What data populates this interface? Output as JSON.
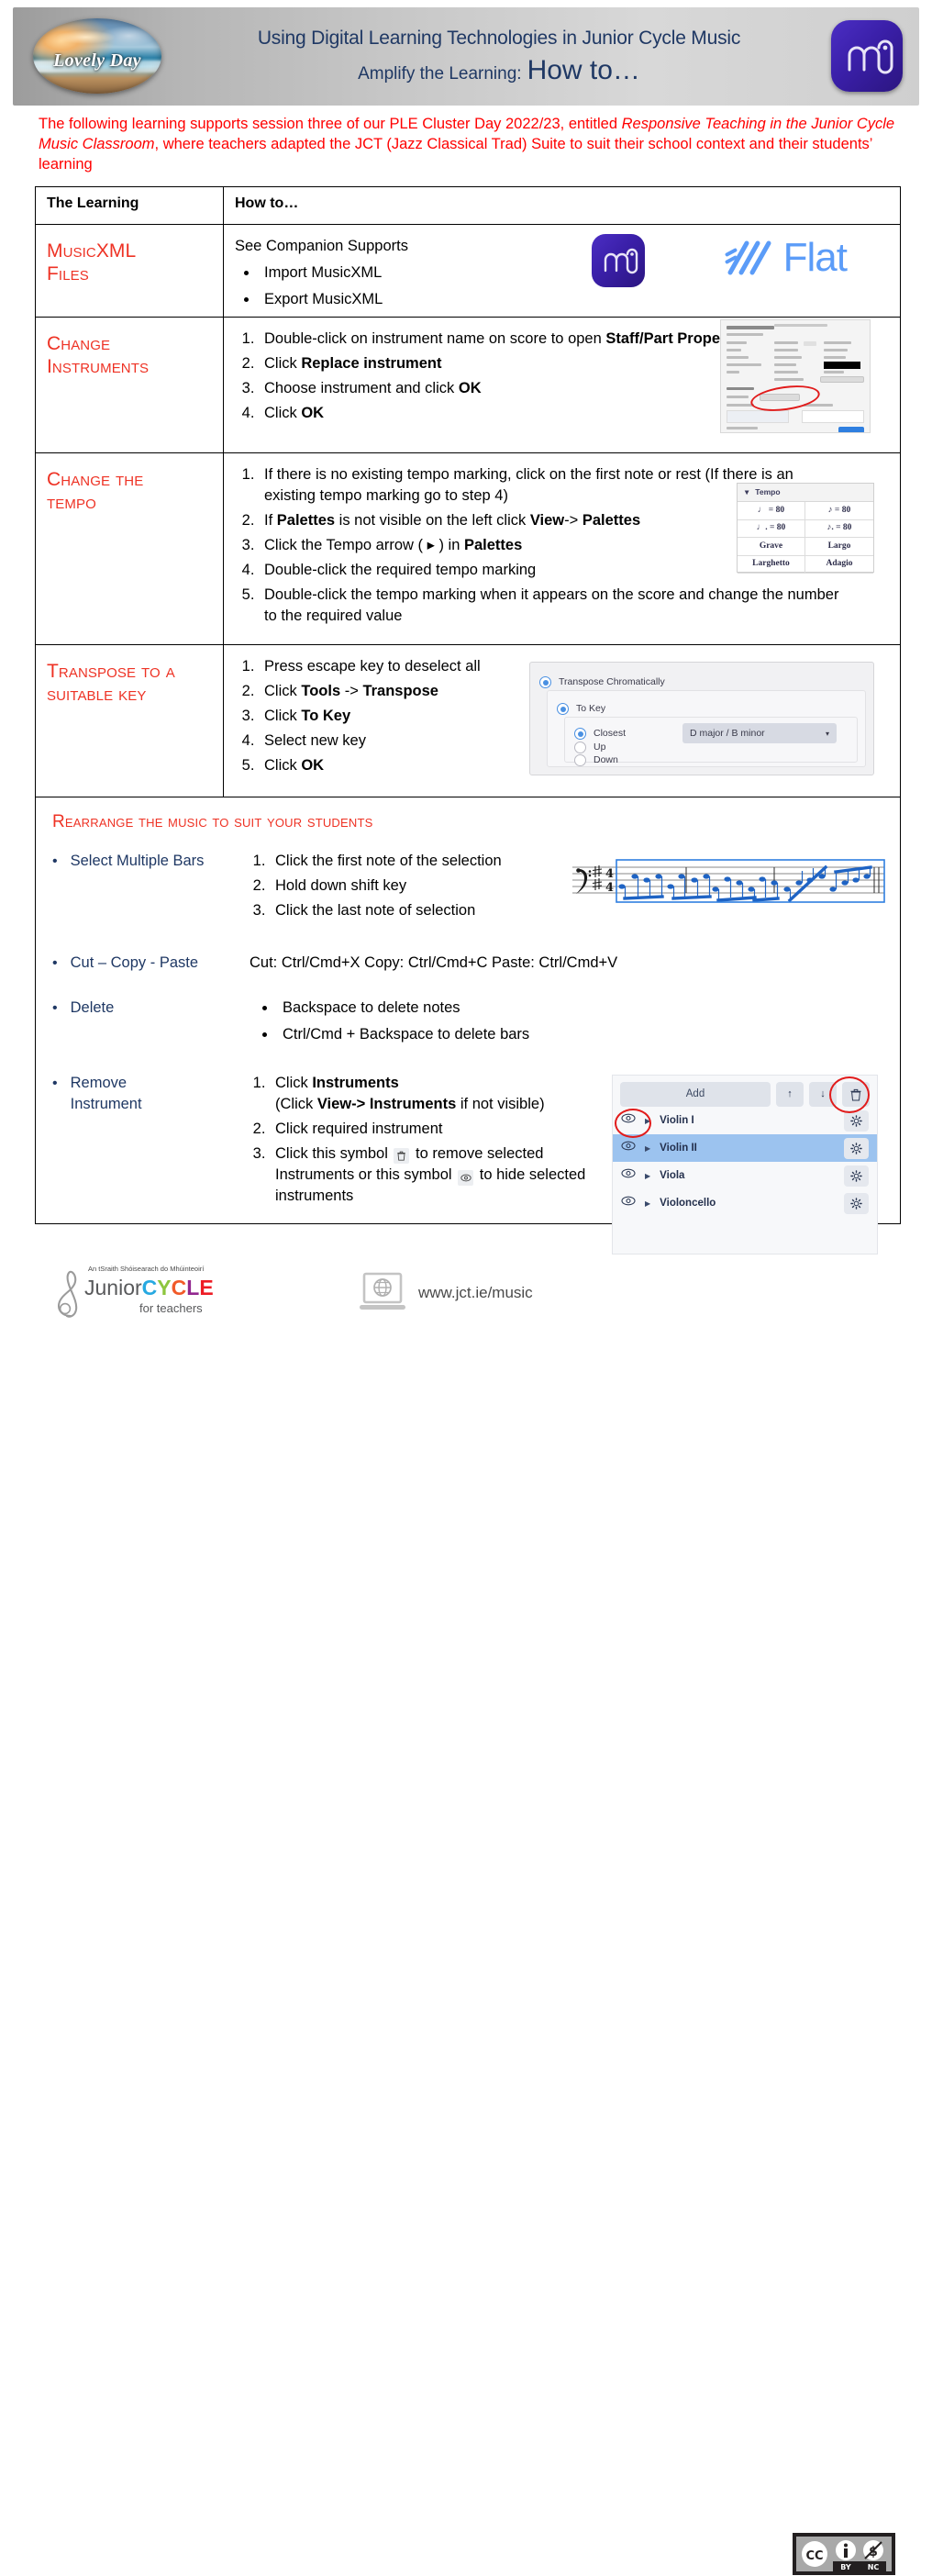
{
  "header": {
    "logo_badge_text": "Lovely Day",
    "title_line1": "Using Digital Learning Technologies in Junior Cycle Music",
    "title_line2_small": "Amplify the Learning:",
    "title_line2_big": "How to…",
    "brand_icon": "musescore-logo-icon",
    "title_color": "#1f3864"
  },
  "intro": {
    "part1": "The following learning supports session three of our PLE Cluster Day 2022/23, entitled ",
    "italic1": "Responsive Teaching in the Junior Cycle Music Classroom",
    "part2": ", where teachers adapted the JCT (Jazz Classical Trad) Suite to suit their school context and their students’ learning",
    "color": "#ff0000"
  },
  "table": {
    "headers": {
      "col1": "The Learning",
      "col2": "How to…"
    },
    "heading_color": "#ee3224",
    "rows": [
      {
        "learning": "MusicXML Files",
        "learning_line1": "MusicXML",
        "learning_line2": "Files",
        "intro_text": "See Companion Supports",
        "bullets": [
          "Import MusicXML",
          "Export MusicXML"
        ],
        "logos": [
          "musescore-logo-icon",
          "flat-logo-icon"
        ],
        "flat_word": "Flat"
      },
      {
        "learning_line1": "Change",
        "learning_line2": "Instruments",
        "steps": [
          {
            "pre": "Double-click on instrument name on score to open ",
            "bold": "Staff/Part Properties",
            "post": ""
          },
          {
            "pre": "Click ",
            "bold": "Replace instrument",
            "post": ""
          },
          {
            "pre": "Choose instrument and click ",
            "bold": "OK",
            "post": ""
          },
          {
            "pre": "Click ",
            "bold": "OK",
            "post": ""
          }
        ],
        "screenshot": "staff-part-properties-screenshot"
      },
      {
        "learning_line1": "Change the",
        "learning_line2": "tempo",
        "steps": [
          {
            "pre": "If there is no existing tempo marking, click on the first note or rest (If there is an existing tempo marking go to step 4)",
            "bold": "",
            "post": ""
          },
          {
            "pre": "If ",
            "bold": "Palettes",
            "post": " is not visible on the left click ",
            "bold2": "View",
            "post2": "-> ",
            "bold3": "Palettes"
          },
          {
            "pre": "Click the Tempo arrow ( ▸ ) in ",
            "bold": "Palettes",
            "post": ""
          },
          {
            "pre": "Double-click the required tempo marking",
            "bold": "",
            "post": ""
          },
          {
            "pre": "Double-click the tempo marking when it appears on the score and change the number to the required value",
            "bold": "",
            "post": ""
          }
        ],
        "tempo_palette": {
          "title": "Tempo",
          "cells": [
            "♩ = 80",
            "♪ = 80",
            "♩. = 80",
            "♪. = 80",
            "Grave",
            "Largo",
            "Larghetto",
            "Adagio"
          ]
        }
      },
      {
        "learning_line1": "Transpose to a",
        "learning_line2": "suitable key",
        "steps": [
          {
            "pre": "Press escape key to deselect all",
            "bold": "",
            "post": ""
          },
          {
            "pre": "Click ",
            "bold": "Tools",
            "post": " -> ",
            "bold2": "Transpose"
          },
          {
            "pre": "Click ",
            "bold": "To Key",
            "post": ""
          },
          {
            "pre": "Select new key",
            "bold": "",
            "post": ""
          },
          {
            "pre": "Click ",
            "bold": "OK",
            "post": ""
          }
        ],
        "transpose_dialog": {
          "option_chromatic": "Transpose Chromatically",
          "option_tokey": "To Key",
          "option_closest": "Closest",
          "option_up": "Up",
          "option_down": "Down",
          "key_value": "D major / B minor"
        }
      }
    ],
    "rearrange": {
      "title": "Rearrange the music to suit your students",
      "items": [
        {
          "label": "Select Multiple Bars",
          "steps": [
            "Click the first note of the selection",
            "Hold down shift key",
            "Click the last note of selection"
          ],
          "image": "music-staff-selection-image"
        },
        {
          "label": "Cut – Copy - Paste",
          "text": "Cut: Ctrl/Cmd+X   Copy: Ctrl/Cmd+C  Paste: Ctrl/Cmd+V"
        },
        {
          "label": "Delete",
          "bullets": [
            "Backspace to delete notes",
            "Ctrl/Cmd + Backspace to delete bars"
          ]
        },
        {
          "label_line1": "Remove",
          "label_line2": "Instrument",
          "steps_rich": [
            {
              "pre": "Click ",
              "bold": "Instruments",
              "post": ""
            },
            {
              "pre": "(Click ",
              "bold": "View-> Instruments",
              "post": " if not visible)"
            },
            {
              "pre": "Click required instrument",
              "bold": "",
              "post": ""
            },
            {
              "pre": "Click this symbol ",
              "mid": " to remove selected Instruments or this symbol ",
              "post": " to hide selected instruments"
            }
          ],
          "instruments_panel": {
            "add_label": "Add",
            "up_icon": "arrow-up-icon",
            "down_icon": "arrow-down-icon",
            "delete_icon": "trash-icon",
            "rows": [
              {
                "name": "Violin I",
                "selected": false
              },
              {
                "name": "Violin II",
                "selected": true
              },
              {
                "name": "Viola",
                "selected": false
              },
              {
                "name": "Violoncello",
                "selected": false
              }
            ]
          }
        }
      ],
      "label_color": "#1f3864"
    }
  },
  "footer": {
    "jc_tagline": "An tSraith Shóisearach do Mhúinteoirí",
    "jc_word_junior": "Junior",
    "jc_word_c": "C",
    "jc_word_y": "Y",
    "jc_word_c2": "C",
    "jc_word_l": "L",
    "jc_word_e": "E",
    "jc_for_teachers": "for teachers",
    "website": "www.jct.ie/music",
    "cc_license": "CC BY NC",
    "cc_by": "BY",
    "cc_nc": "NC"
  }
}
